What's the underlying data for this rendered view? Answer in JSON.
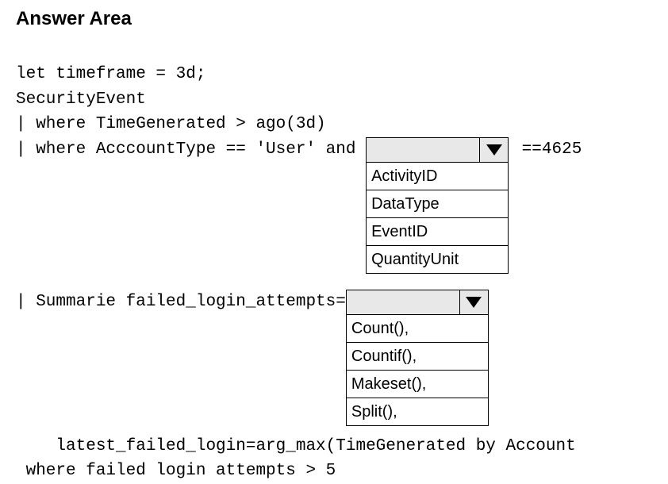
{
  "title": "Answer Area",
  "code": {
    "line1": "let timeframe = 3d;",
    "line2": "SecurityEvent",
    "line3": "| where TimeGenerated > ago(3d)",
    "line4_prefix": "| where AcccountType == 'User' and ",
    "line4_suffix": " ==4625",
    "line5_prefix": "| Summarie failed_login_attempts=",
    "line6": "    latest_failed_login=arg_max(TimeGenerated by Account",
    "line7": " where failed login attempts > 5"
  },
  "dropdown1": {
    "selected": "",
    "options": [
      "ActivityID",
      "DataType",
      "EventID",
      "QuantityUnit"
    ]
  },
  "dropdown2": {
    "selected": "",
    "options": [
      "Count(),",
      "Countif(),",
      "Makeset(),",
      "Split(),"
    ]
  }
}
